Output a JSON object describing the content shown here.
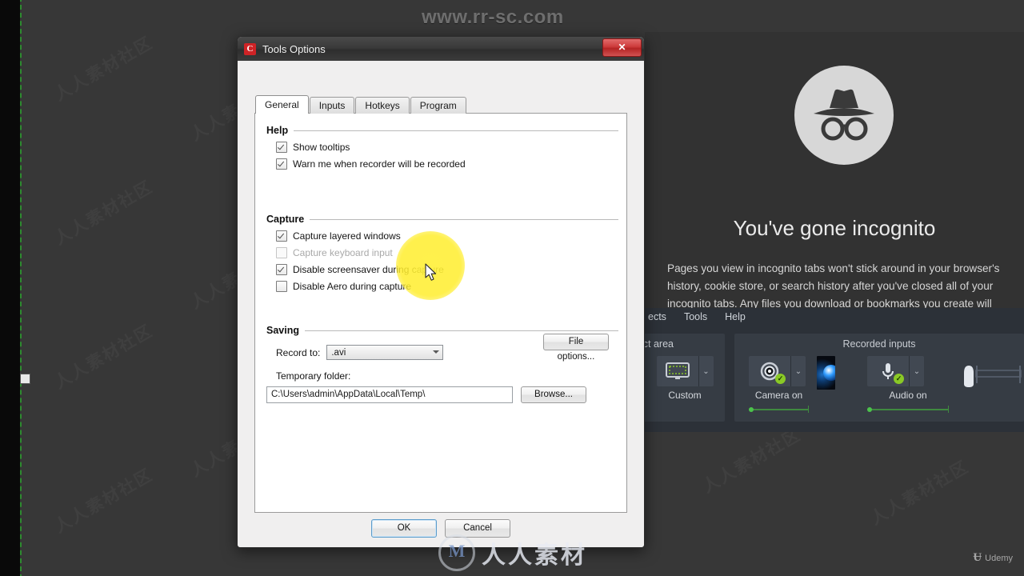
{
  "desktop": {
    "site_watermark": "www.rr-sc.com",
    "bottom_watermark_text": "人人素材",
    "bottom_watermark_logo": "M",
    "udemy_watermark": "Udemy",
    "udemy_mark": "Ʉ",
    "capture_border_color": "#2e8b30",
    "background_color": "#373737"
  },
  "incognito": {
    "icon": "incognito-hat-glasses-icon",
    "title": "You've gone incognito",
    "body": "Pages you view in incognito tabs won't stick around in your browser's history, cookie store, or search history after you've closed all of your incognito tabs. Any files you download or bookmarks you create will be kept."
  },
  "recorder": {
    "menu": [
      "ects",
      "Tools",
      "Help"
    ],
    "select_area": {
      "title": "ect area",
      "button_label": "Custom",
      "icon": "monitor-selection-icon",
      "caret": "⌄"
    },
    "recorded_inputs": {
      "title": "Recorded inputs",
      "camera": {
        "label": "Camera on",
        "icon": "webcam-icon",
        "badge": "✓",
        "caret": "⌄"
      },
      "audio": {
        "label": "Audio on",
        "icon": "microphone-icon",
        "badge": "✓",
        "caret": "⌄"
      },
      "camera_preview": "camera-preview-thumbnail",
      "audio_meter": "audio-level-meter"
    }
  },
  "dialog": {
    "title": "Tools Options",
    "app_icon": "C",
    "close_label": "✕",
    "tabs": [
      {
        "label": "General",
        "active": true
      },
      {
        "label": "Inputs",
        "active": false
      },
      {
        "label": "Hotkeys",
        "active": false
      },
      {
        "label": "Program",
        "active": false
      }
    ],
    "groups": {
      "help": {
        "title": "Help",
        "items": [
          {
            "label": "Show tooltips",
            "checked": true,
            "disabled": false
          },
          {
            "label": "Warn me when recorder will be recorded",
            "checked": true,
            "disabled": false
          }
        ]
      },
      "capture": {
        "title": "Capture",
        "items": [
          {
            "label": "Capture layered windows",
            "checked": true,
            "disabled": false
          },
          {
            "label": "Capture keyboard input",
            "checked": false,
            "disabled": true
          },
          {
            "label": "Disable screensaver during capture",
            "checked": true,
            "disabled": false
          },
          {
            "label": "Disable Aero during capture",
            "checked": false,
            "disabled": false
          }
        ]
      },
      "saving": {
        "title": "Saving",
        "record_to_label": "Record to:",
        "record_to_value": ".avi",
        "file_options_label": "File options...",
        "temp_folder_label": "Temporary folder:",
        "temp_folder_value": "C:\\Users\\admin\\AppData\\Local\\Temp\\",
        "browse_label": "Browse..."
      }
    },
    "footer": {
      "ok_label": "OK",
      "cancel_label": "Cancel"
    }
  }
}
